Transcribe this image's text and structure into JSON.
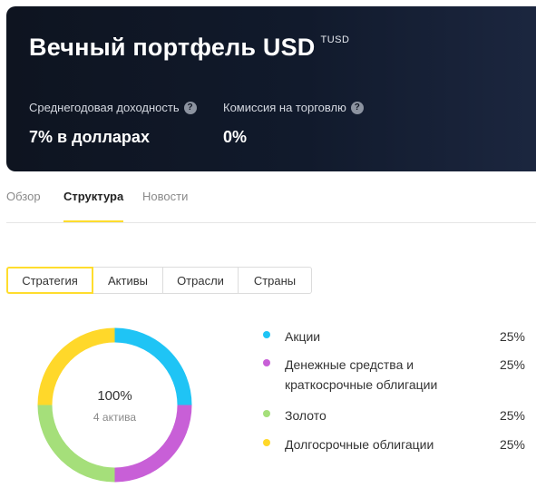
{
  "header": {
    "title": "Вечный портфель USD",
    "ticker": "TUSD",
    "metrics": [
      {
        "label": "Среднегодовая доходность",
        "value": "7% в долларах"
      },
      {
        "label": "Комиссия на торговлю",
        "value": "0%"
      }
    ],
    "help_icon": "question-circle-icon"
  },
  "tabs": [
    {
      "label": "Обзор",
      "active": false
    },
    {
      "label": "Структура",
      "active": true
    },
    {
      "label": "Новости",
      "active": false
    }
  ],
  "segments": [
    {
      "label": "Стратегия",
      "active": true
    },
    {
      "label": "Активы",
      "active": false
    },
    {
      "label": "Отрасли",
      "active": false
    },
    {
      "label": "Страны",
      "active": false
    }
  ],
  "donut": {
    "total": "100%",
    "subtitle": "4 актива"
  },
  "chart_data": {
    "type": "pie",
    "categories": [
      "Акции",
      "Денежные средства и краткосрочные облигации",
      "Золото",
      "Долгосрочные облигации"
    ],
    "values": [
      25,
      25,
      25,
      25
    ],
    "colors": [
      "#1fc4f5",
      "#c85fd7",
      "#a5df7a",
      "#ffd82a"
    ]
  },
  "legend": [
    {
      "name_lines": [
        "Акции"
      ],
      "pct": "25%",
      "color": "#1fc4f5"
    },
    {
      "name_lines": [
        "Денежные средства и",
        "краткосрочные облигации"
      ],
      "pct": "25%",
      "color": "#c85fd7"
    },
    {
      "name_lines": [
        "Золото"
      ],
      "pct": "25%",
      "color": "#a5df7a"
    },
    {
      "name_lines": [
        "Долгосрочные облигации"
      ],
      "pct": "25%",
      "color": "#ffd82a"
    }
  ]
}
